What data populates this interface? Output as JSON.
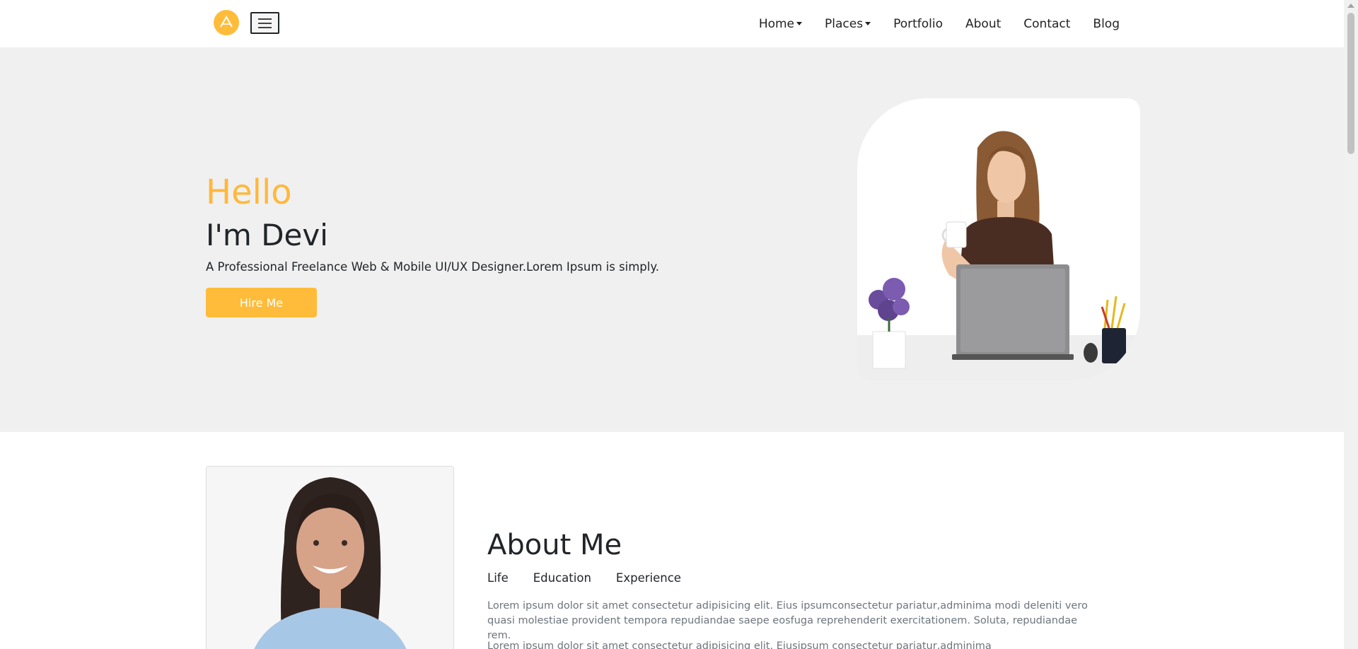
{
  "nav": {
    "brand_icon": "logo-a-icon",
    "menu_icon": "hamburger-menu-icon",
    "items": [
      {
        "label": "Home",
        "dropdown": true
      },
      {
        "label": "Places",
        "dropdown": true
      },
      {
        "label": "Portfolio",
        "dropdown": false
      },
      {
        "label": "About",
        "dropdown": false
      },
      {
        "label": "Contact",
        "dropdown": false
      },
      {
        "label": "Blog",
        "dropdown": false
      }
    ]
  },
  "hero": {
    "greeting": "Hello",
    "name": "I'm Devi",
    "description": "A Professional Freelance Web & Mobile UI/UX Designer.Lorem Ipsum is simply.",
    "cta_label": "Hire Me"
  },
  "about": {
    "title": "About Me",
    "tabs": [
      "Life",
      "Education",
      "Experience"
    ],
    "paragraph_1": "Lorem ipsum dolor sit amet consectetur adipisicing elit. Eius ipsumconsectetur pariatur,adminima modi deleniti vero quasi molestiae provident tempora repudiandae saepe eosfuga reprehenderit exercitationem. Soluta, repudiandae rem.",
    "paragraph_2": "Lorem ipsum dolor sit amet consectetur adipisicing elit. Eiusipsum consectetur pariatur,adminima"
  },
  "colors": {
    "accent": "#ffbc3a",
    "hero_bg": "#f0f0f0",
    "text": "#212529",
    "muted": "#6c757d"
  }
}
